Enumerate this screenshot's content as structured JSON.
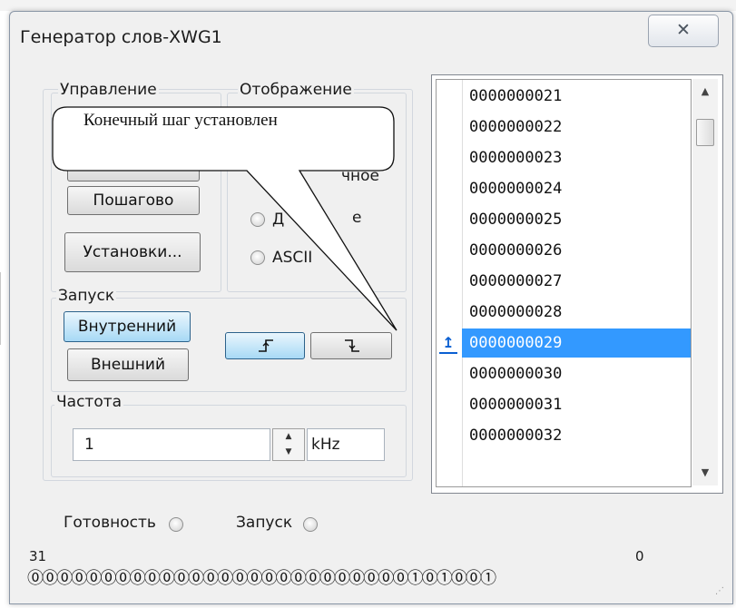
{
  "window": {
    "title": "Генератор слов-XWG1",
    "close_glyph": "✕"
  },
  "control": {
    "label": "Управление",
    "step_button": "Пошагово",
    "settings_button": "Установки..."
  },
  "display": {
    "label": "Отображение",
    "partial_text": "чное",
    "decimal_prefix": "Д",
    "decimal_suffix": "е",
    "ascii_label": "ASCII"
  },
  "trigger": {
    "label": "Запуск",
    "internal_button": "Внутренний",
    "external_button": "Внешний",
    "rising_edge_icon": "rising-edge",
    "falling_edge_icon": "falling-edge",
    "active_color": "#a7d9f5"
  },
  "frequency": {
    "label": "Частота",
    "value": "1",
    "unit": "kHz"
  },
  "tooltip": {
    "text": "Конечный шаг установлен"
  },
  "word_list": {
    "rows": [
      "0000000021",
      "0000000022",
      "0000000023",
      "0000000024",
      "0000000025",
      "0000000026",
      "0000000027",
      "0000000028",
      "0000000029",
      "0000000030",
      "0000000031",
      "0000000032"
    ],
    "selected_row": "0000000029",
    "selected_color": "#3399ff",
    "marker_icon": "up-arrow-marker"
  },
  "status": {
    "ready_label": "Готовность",
    "run_label": "Запуск"
  },
  "bits": {
    "high_label": "31",
    "low_label": "0",
    "values": "00000000000000000000000000101001"
  }
}
